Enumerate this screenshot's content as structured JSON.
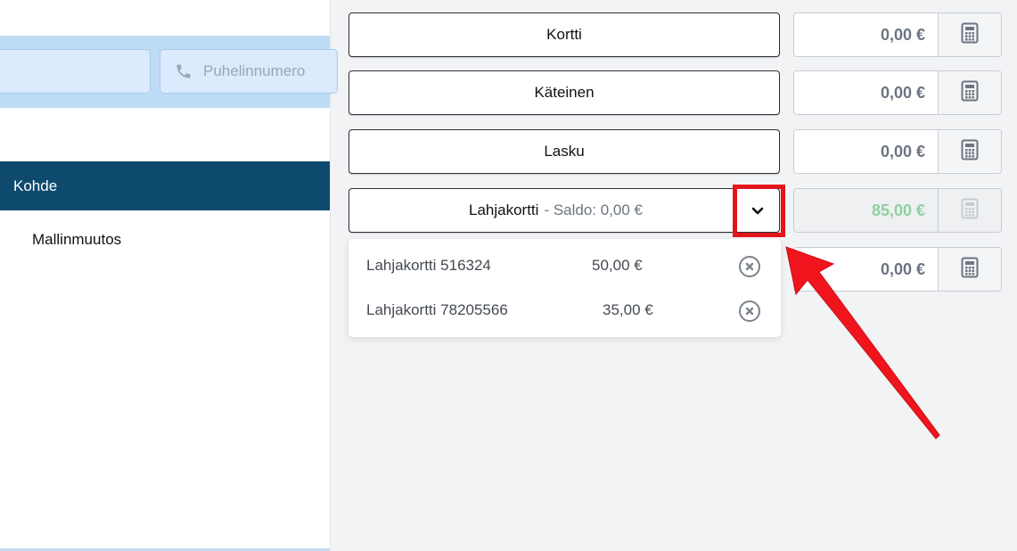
{
  "contact": {
    "phone_placeholder": "Puhelinnumero"
  },
  "target": {
    "header": "Kohde",
    "item": "Mallinmuutos"
  },
  "payments": {
    "kortti": {
      "label": "Kortti",
      "amount": "0,00 €"
    },
    "kateinen": {
      "label": "Käteinen",
      "amount": "0,00 €"
    },
    "lasku": {
      "label": "Lasku",
      "amount": "0,00 €"
    },
    "lahjakortti": {
      "label": "Lahjakortti",
      "sub": "- Saldo: 0,00 €",
      "amount": "85,00 €"
    },
    "fifth": {
      "amount": "0,00 €"
    }
  },
  "gift_cards": [
    {
      "name": "Lahjakortti 516324",
      "amount": "50,00 €"
    },
    {
      "name": "Lahjakortti 78205566",
      "amount": "35,00 €"
    }
  ],
  "colors": {
    "nav_dark": "#0e4a6e",
    "band_blue": "#bfdcf7",
    "annotation_red": "#e3141c",
    "paid_green": "#8fd0a0"
  },
  "icons": [
    "phone-icon",
    "calculator-icon",
    "chevron-down-icon",
    "remove-circle-icon"
  ]
}
